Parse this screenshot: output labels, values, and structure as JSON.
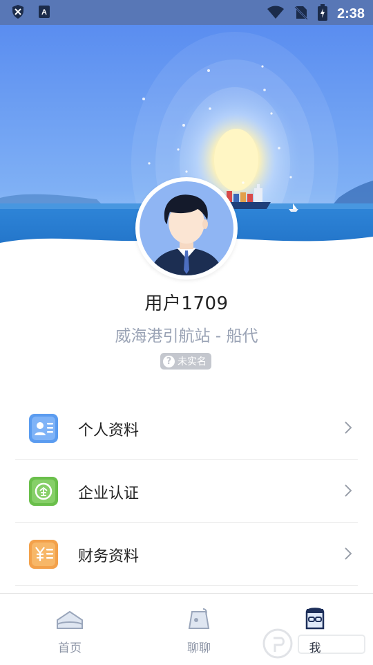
{
  "status_bar": {
    "time": "2:38"
  },
  "profile": {
    "name": "用户1709",
    "organization": "威海港引航站 - 船代",
    "verify_status": "未实名",
    "verify_icon": "?"
  },
  "menu": {
    "items": [
      {
        "label": "个人资料",
        "icon": "id-card-icon",
        "color": "#5b9cf0"
      },
      {
        "label": "企业认证",
        "icon": "enterprise-icon",
        "color": "#6abf4b"
      },
      {
        "label": "财务资料",
        "icon": "finance-icon",
        "color": "#f3a14b"
      }
    ]
  },
  "tabs": [
    {
      "label": "首页",
      "icon": "home-icon",
      "active": false
    },
    {
      "label": "聊聊",
      "icon": "chat-icon",
      "active": false
    },
    {
      "label": "我",
      "icon": "me-icon",
      "active": true
    }
  ],
  "colors": {
    "status_bar": "#5877b6",
    "sky_top": "#4f7ee6",
    "sea": "#3a8ad8",
    "sun": "#fff3b0"
  }
}
